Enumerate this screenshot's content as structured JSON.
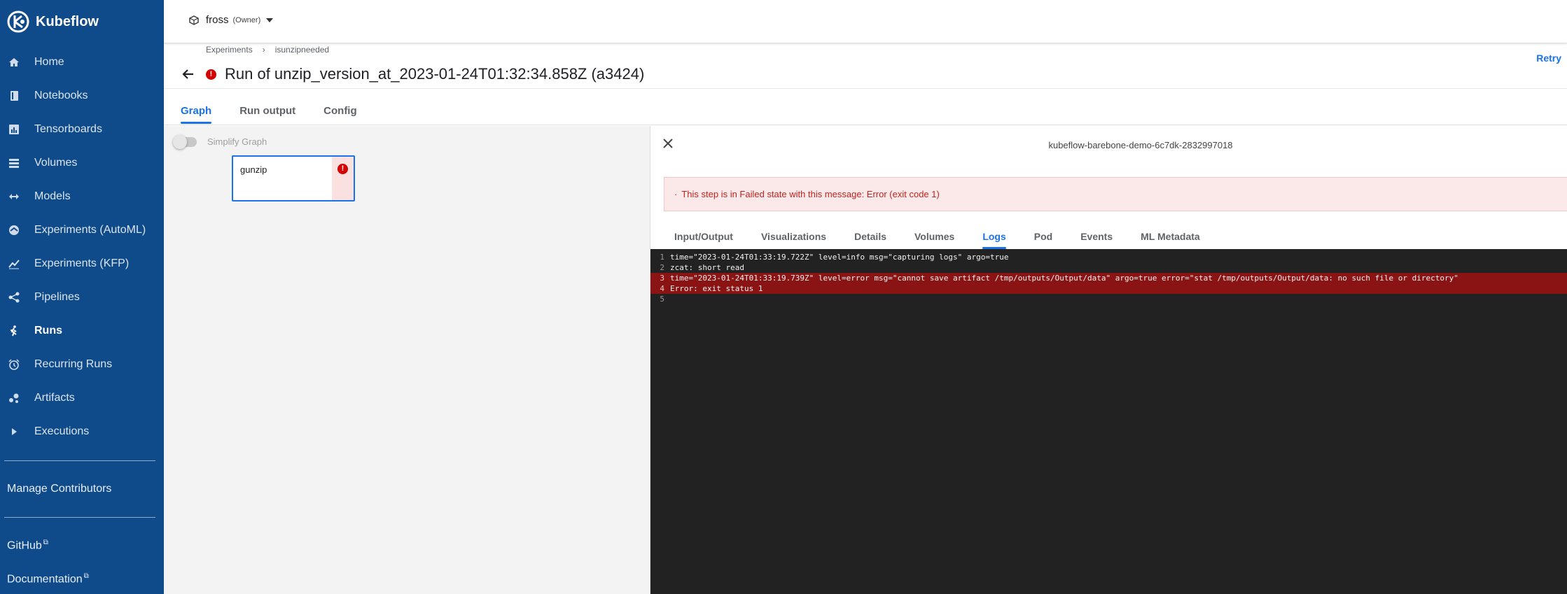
{
  "app": {
    "name": "Kubeflow"
  },
  "sidebar": {
    "items": [
      {
        "label": "Home",
        "icon": "home-icon"
      },
      {
        "label": "Notebooks",
        "icon": "notebook-icon"
      },
      {
        "label": "Tensorboards",
        "icon": "tensorboard-icon"
      },
      {
        "label": "Volumes",
        "icon": "volumes-icon"
      },
      {
        "label": "Models",
        "icon": "models-icon"
      },
      {
        "label": "Experiments (AutoML)",
        "icon": "automl-icon"
      },
      {
        "label": "Experiments (KFP)",
        "icon": "kfp-icon"
      },
      {
        "label": "Pipelines",
        "icon": "pipelines-icon"
      },
      {
        "label": "Runs",
        "icon": "runs-icon",
        "active": true
      },
      {
        "label": "Recurring Runs",
        "icon": "alarm-icon"
      },
      {
        "label": "Artifacts",
        "icon": "artifacts-icon"
      },
      {
        "label": "Executions",
        "icon": "play-icon"
      }
    ],
    "manage_contributors": "Manage Contributors",
    "github": "GitHub",
    "documentation": "Documentation"
  },
  "namespace": {
    "name": "fross",
    "role": "(Owner)"
  },
  "breadcrumb": {
    "root": "Experiments",
    "separator": "›",
    "current": "isunzipneeded"
  },
  "run": {
    "title": "Run of unzip_version_at_2023-01-24T01:32:34.858Z (a3424)",
    "retry": "Retry"
  },
  "main_tabs": [
    "Graph",
    "Run output",
    "Config"
  ],
  "graph": {
    "simplify_label": "Simplify Graph",
    "node_name": "gunzip"
  },
  "panel": {
    "pod_name": "kubeflow-barebone-demo-6c7dk-2832997018",
    "alert_bullet": "·",
    "alert": "This step is in Failed state with this message: Error (exit code 1)",
    "tabs": [
      "Input/Output",
      "Visualizations",
      "Details",
      "Volumes",
      "Logs",
      "Pod",
      "Events",
      "ML Metadata"
    ],
    "active_tab": "Logs",
    "logs": [
      {
        "n": "1",
        "text": "time=\"2023-01-24T01:33:19.722Z\" level=info msg=\"capturing logs\" argo=true",
        "error": false
      },
      {
        "n": "2",
        "text": "zcat: short read",
        "error": false
      },
      {
        "n": "3",
        "text": "time=\"2023-01-24T01:33:19.739Z\" level=error msg=\"cannot save artifact /tmp/outputs/Output/data\" argo=true error=\"stat /tmp/outputs/Output/data: no such file or directory\"",
        "error": true
      },
      {
        "n": "4",
        "text": "Error: exit status 1",
        "error": true
      },
      {
        "n": "5",
        "text": "",
        "error": false
      }
    ]
  },
  "colors": {
    "sidebar": "#0f4b8b",
    "accent": "#1a73e8",
    "error": "#d50000",
    "log_bg": "#222222",
    "log_error_bg": "#8a1414"
  }
}
